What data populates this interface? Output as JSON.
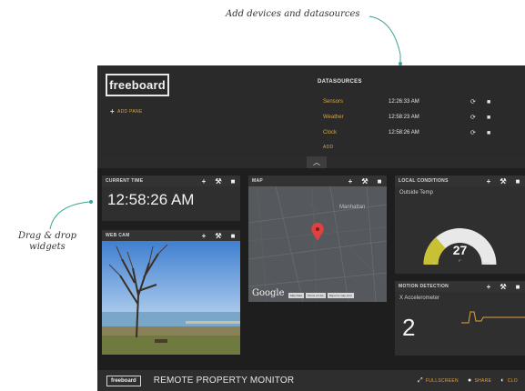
{
  "annotations": {
    "top_note": "Add devices and datasources",
    "left_note_line1": "Drag & drop",
    "left_note_line2": "widgets"
  },
  "header": {
    "logo": "freeboard",
    "add_pane_label": "ADD PANE"
  },
  "datasources": {
    "title": "DATASOURCES",
    "rows": [
      {
        "name": "Sensors",
        "time": "12:26:33 AM"
      },
      {
        "name": "Weather",
        "time": "12:58:23 AM"
      },
      {
        "name": "Clock",
        "time": "12:58:26 AM"
      }
    ],
    "add_label": "ADD"
  },
  "icons": {
    "refresh": "refresh-icon",
    "delete": "trash-icon",
    "add": "plus-icon",
    "edit": "wrench-icon",
    "collapse": "chevron-up-icon"
  },
  "panes": {
    "current_time": {
      "title": "CURRENT TIME",
      "value": "12:58:26 AM"
    },
    "map": {
      "title": "MAP",
      "place_label": "Manhattan",
      "brand": "Google",
      "footer_items": [
        "Map Data",
        "Terms of Use",
        "Report a map error"
      ]
    },
    "webcam": {
      "title": "WEB CAM"
    },
    "local_conditions": {
      "title": "LOCAL CONDITIONS",
      "label": "Outside Temp",
      "value": "27",
      "unit": "F",
      "min": "0",
      "max": "100",
      "fraction": 0.27
    },
    "motion": {
      "title": "MOTION DETECTION",
      "label": "X Accelerometer",
      "value": "2"
    }
  },
  "footer": {
    "logo": "freeboard",
    "title": "REMOTE PROPERTY MONITOR",
    "fullscreen": "FULLSCREEN",
    "share": "SHARE",
    "clone": "CLO"
  },
  "colors": {
    "accent": "#e0a23a",
    "gauge_fill": "#c9c134",
    "gauge_track": "#e8e8e8",
    "sparkline": "#e0a23a",
    "map_pin": "#e04040"
  }
}
